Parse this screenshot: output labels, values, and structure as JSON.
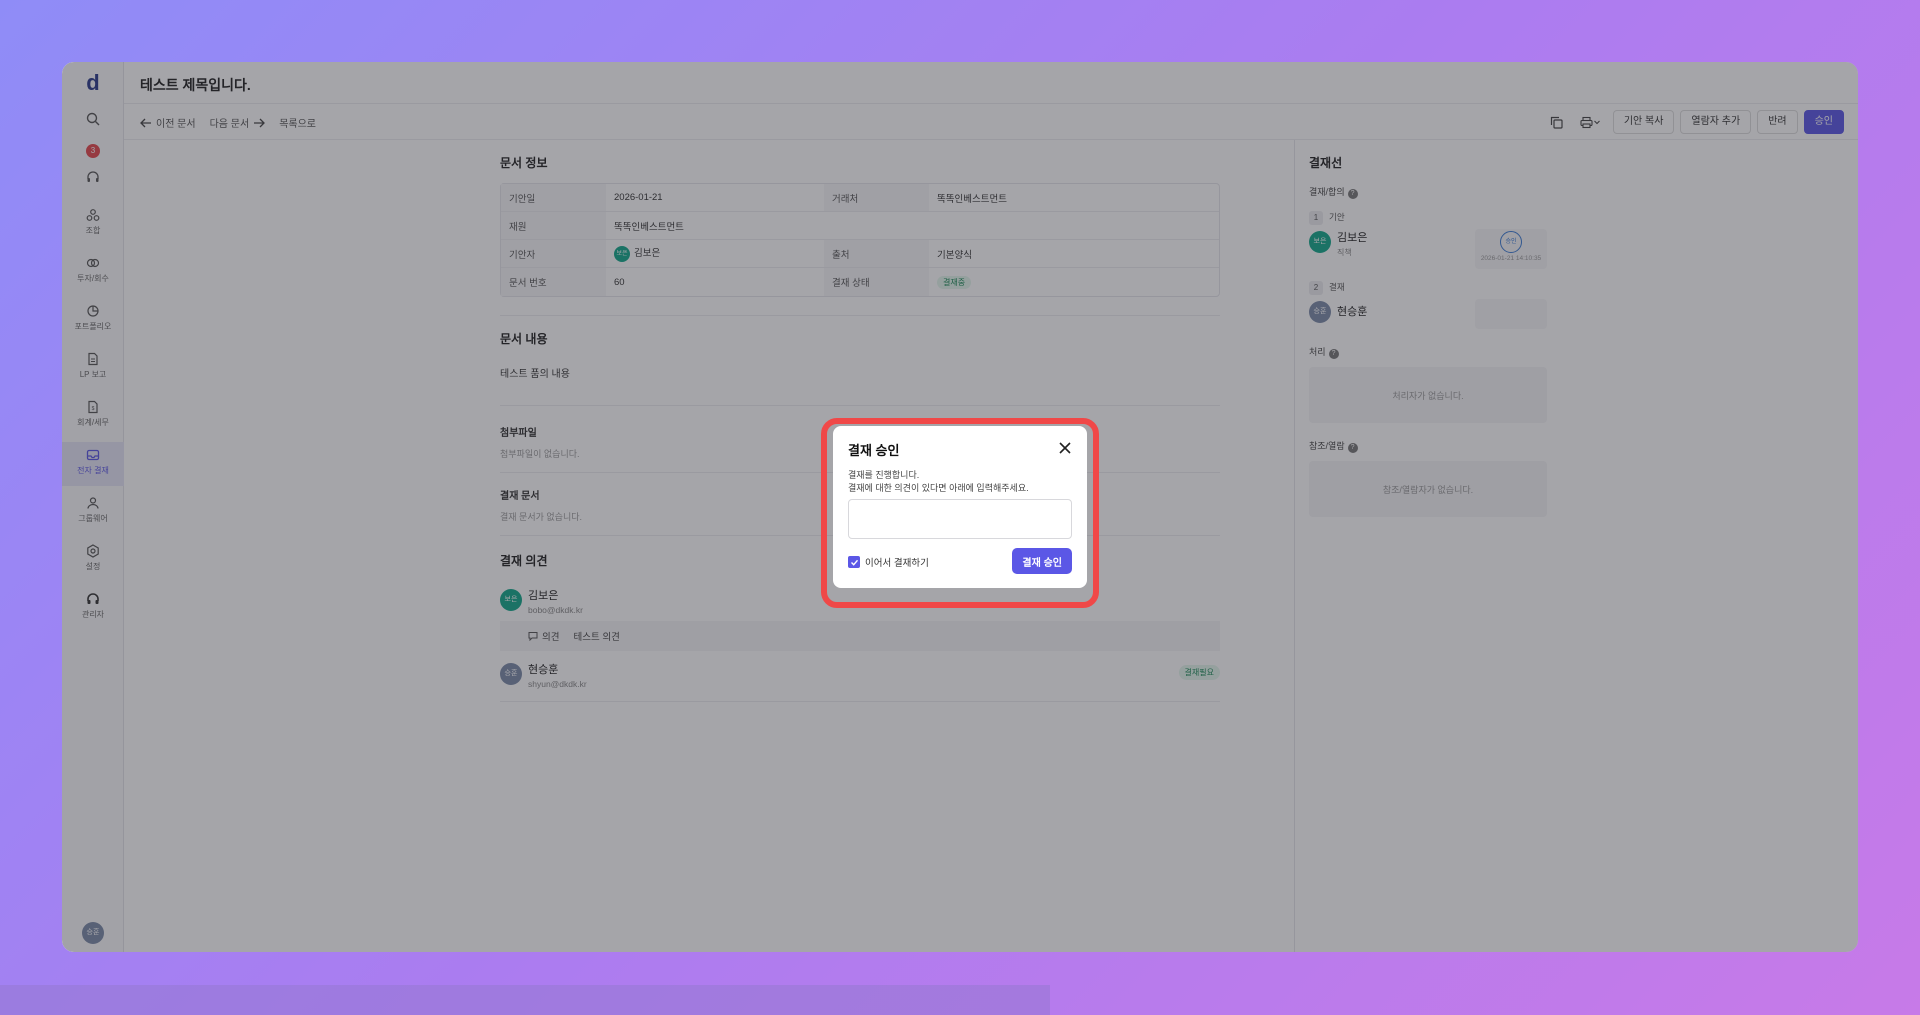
{
  "app": {
    "logo": "d",
    "title": "테스트 제목입니다."
  },
  "sidebar": {
    "notification_count": "3",
    "items": [
      {
        "label": "조합"
      },
      {
        "label": "투자/회수"
      },
      {
        "label": "포트폴리오"
      },
      {
        "label": "LP 보고"
      },
      {
        "label": "회계/세무"
      },
      {
        "label": "전자 결재"
      },
      {
        "label": "그룹웨어"
      },
      {
        "label": "설정"
      },
      {
        "label": "관리자"
      }
    ],
    "avatar": "승훈"
  },
  "toolbar": {
    "prev": "이전 문서",
    "next": "다음 문서",
    "list": "목록으로",
    "copy_draft": "기안 복사",
    "add_viewer": "열람자 추가",
    "reject": "반려",
    "approve": "승인"
  },
  "doc_info": {
    "title": "문서 정보",
    "draft_date_label": "기안일",
    "draft_date": "2026-01-21",
    "partner_label": "거래처",
    "partner": "똑똑인베스트먼트",
    "fund_label": "재원",
    "fund": "똑똑인베스트먼트",
    "drafter_label": "기안자",
    "drafter": "김보은",
    "drafter_avatar": "보은",
    "source_label": "출처",
    "source": "기본양식",
    "doc_no_label": "문서 번호",
    "doc_no": "60",
    "status_label": "결재 상태",
    "status": "결재중"
  },
  "doc_content": {
    "title": "문서 내용",
    "body": "테스트 품의 내용"
  },
  "attachments": {
    "title": "첨부파일",
    "empty": "첨부파일이 없습니다."
  },
  "approval_docs": {
    "title": "결재 문서",
    "empty": "결재 문서가 없습니다."
  },
  "opinions": {
    "title": "결재 의견",
    "items": [
      {
        "name": "김보은",
        "email": "bobo@dkdk.kr",
        "avatar": "보은"
      },
      {
        "name": "현승훈",
        "email": "shyun@dkdk.kr",
        "avatar": "승훈",
        "status": "결재필요"
      }
    ],
    "comment_label": "의견",
    "comment_text": "테스트 의견"
  },
  "approval_line": {
    "title": "결재선",
    "group_label": "결재/합의",
    "steps": [
      {
        "num": "1",
        "type": "기안",
        "name": "김보은",
        "role": "직책",
        "avatar": "보은",
        "stamp": "승인",
        "time": "2026-01-21 14:10:35"
      },
      {
        "num": "2",
        "type": "결재",
        "name": "현승훈",
        "avatar": "승훈"
      }
    ],
    "process_label": "처리",
    "process_empty": "처리자가 없습니다.",
    "ref_label": "참조/열람",
    "ref_empty": "참조/열람자가 없습니다."
  },
  "modal": {
    "title": "결재 승인",
    "desc_line1": "결재를 진행합니다.",
    "desc_line2": "결재에 대한 의견이 있다면 아래에 입력해주세요.",
    "comment_value": "",
    "continue_label": "이어서 결재하기",
    "continue_checked": true,
    "submit": "결재 승인"
  },
  "colors": {
    "accent": "#5b57e6",
    "highlight": "#f04848",
    "success": "#1b8a57"
  }
}
